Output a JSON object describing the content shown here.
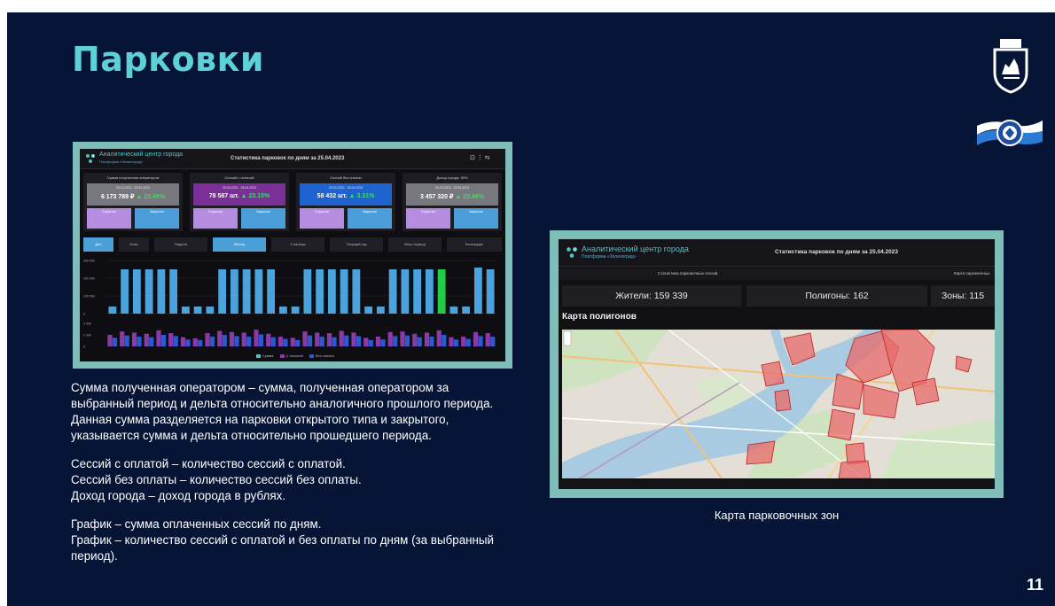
{
  "slide": {
    "title": "Парковки",
    "page_number": "11",
    "map_caption": "Карта парковочных зон"
  },
  "dashboard": {
    "app_name": "Аналитический центр города",
    "app_sub": "Платформа «Зеленоград»",
    "title": "Статистика парковок по дням за 25.04.2023",
    "cards": [
      {
        "title": "Сумма полученная оператором",
        "dates": "20.03.2023 - 25.04.2023",
        "value": "6 173 789 ₽",
        "delta": "▲ 20.49%",
        "color": "#77777e",
        "mini1_label": "Открытые",
        "mini2_label": "Закрытые"
      },
      {
        "title": "Сессий с оплатой",
        "dates": "20.03.2023 - 25.04.2023",
        "value": "78 587 шт.",
        "delta": "▲ 23.15%",
        "color": "#7a2f97",
        "mini1_label": "Открытые",
        "mini2_label": "Закрытые"
      },
      {
        "title": "Сессий без оплаты",
        "dates": "20.03.2023 - 25.04.2023",
        "value": "58 432 шт.",
        "delta": "▲ 3.31%",
        "color": "#1e63cf",
        "mini1_label": "Открытые",
        "mini2_label": "Закрытые"
      },
      {
        "title": "Доход города, 90%",
        "dates": "20.03.2023 - 25.04.2023",
        "value": "3 457 320 ₽",
        "delta": "▲ 20.49%",
        "color": "#77777e",
        "mini1_label": "Открытые",
        "mini2_label": "Закрытые"
      }
    ],
    "tabs": [
      "Дни",
      "Зоны",
      "Недели",
      "Месяц",
      "2 месяца",
      "Текущий год",
      "Весь период",
      "Календарь"
    ],
    "active_tabs": [
      0,
      3
    ],
    "legend": [
      "Сумма",
      "С оплатой",
      "Без оплаты"
    ],
    "colors": {
      "bar": "#4aa3dc",
      "highlight": "#22cc44",
      "paid": "#8a3aa8",
      "unpaid": "#2a5ad0"
    }
  },
  "chart_data": [
    {
      "type": "bar",
      "title": "",
      "ylabel": "",
      "y_ticks": [
        "300 000",
        "200 000",
        "100 000",
        "0"
      ],
      "ylim": [
        0,
        300000
      ],
      "values": [
        40000,
        250000,
        250000,
        250000,
        250000,
        250000,
        40000,
        40000,
        40000,
        250000,
        250000,
        250000,
        250000,
        250000,
        40000,
        40000,
        250000,
        250000,
        250000,
        250000,
        250000,
        40000,
        40000,
        250000,
        250000,
        250000,
        250000,
        250000,
        40000,
        40000,
        260000,
        250000
      ],
      "highlight_index": 27
    },
    {
      "type": "bar",
      "y_ticks": [
        "4 000",
        "2 000",
        "0"
      ],
      "series": [
        {
          "name": "С оплатой",
          "values": [
            2000,
            2600,
            2400,
            2200,
            2800,
            2300,
            1600,
            1400,
            2300,
            2700,
            2500,
            2400,
            2900,
            2200,
            1700,
            1500,
            2600,
            2400,
            2300,
            2700,
            2400,
            1500,
            1700,
            2500,
            2600,
            2200,
            2400,
            2800,
            1600,
            1700,
            2500,
            2300
          ]
        },
        {
          "name": "Без оплаты",
          "values": [
            1500,
            1900,
            1700,
            1600,
            2000,
            1800,
            1200,
            1100,
            1700,
            2000,
            1800,
            1700,
            2100,
            1600,
            1300,
            1100,
            1900,
            1700,
            1600,
            1900,
            1800,
            1100,
            1200,
            1800,
            1900,
            1600,
            1700,
            2000,
            1200,
            1300,
            1800,
            1700
          ]
        }
      ]
    }
  ],
  "description": {
    "p1": "Сумма полученная оператором – сумма, полученная оператором за выбранный период и дельта относительно аналогичного прошлого периода. Данная сумма разделяется на парковки открытого типа и закрытого, указывается сумма и дельта относительно прошедшего периода.",
    "p2": "Сессий с оплатой – количество сессий с оплатой.",
    "p3": "Сессий без оплаты – количество сессий без оплаты.",
    "p4": "Доход города – доход города в рублях.",
    "p5": "График – сумма оплаченных сессий по дням.",
    "p6": "График – количество сессий с оплатой и без оплаты по дням (за выбранный период)."
  },
  "map_panel": {
    "app_name": "Аналитический центр города",
    "app_sub": "Платформа «Зеленоград»",
    "title": "Статистика парковок по дням за 25.04.2023",
    "tab_left": "Статистика парковочных сессий",
    "tab_right": "Карта парковочных",
    "stat_residents": "Жители: 159 339",
    "stat_polygons": "Полигоны: 162",
    "stat_zones": "Зоны: 115",
    "map_title": "Карта полигонов"
  }
}
